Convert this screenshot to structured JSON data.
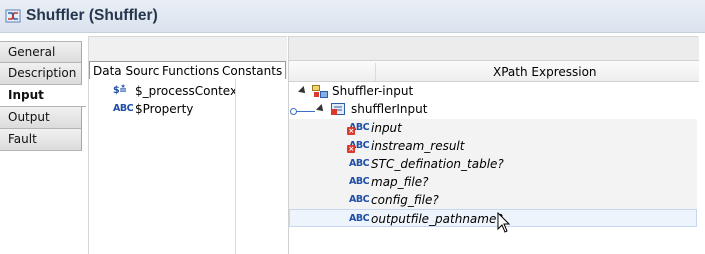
{
  "window": {
    "title": "Shuffler (Shuffler)",
    "icon": "shuffler-icon"
  },
  "tabs": [
    {
      "label": "General",
      "active": false
    },
    {
      "label": "Description",
      "active": false
    },
    {
      "label": "Input",
      "active": true
    },
    {
      "label": "Output",
      "active": false
    },
    {
      "label": "Fault",
      "active": false
    }
  ],
  "data_source_panel": {
    "subtabs": [
      {
        "label": "Data Source",
        "active": true
      },
      {
        "label": "Functions",
        "active": false
      },
      {
        "label": "Constants",
        "active": false
      }
    ],
    "items": [
      {
        "icon": "process-context-icon",
        "glyph": "$≛",
        "label": "$_processContext"
      },
      {
        "icon": "string-type-icon",
        "glyph": "ABC",
        "label": "$Property"
      }
    ]
  },
  "xpath_panel": {
    "column_header": "XPath Expression",
    "tree": {
      "root": {
        "label": "Shuffler-input",
        "icon": "schema-root-icon"
      },
      "child": {
        "label": "shufflerInput",
        "icon": "complex-element-icon"
      },
      "fields": [
        {
          "label": "input",
          "glyph": "ABC",
          "error": true
        },
        {
          "label": "instream_result",
          "glyph": "ABC",
          "error": true
        },
        {
          "label": "STC_defination_table?",
          "glyph": "ABC",
          "error": false
        },
        {
          "label": "map_file?",
          "glyph": "ABC",
          "error": false
        },
        {
          "label": "config_file?",
          "glyph": "ABC",
          "error": false
        },
        {
          "label": "outputfile_pathname?",
          "glyph": "ABC",
          "error": false
        }
      ]
    }
  },
  "colors": {
    "title_text": "#25364d",
    "type_icon": "#1f4fa8",
    "error_badge": "#d93a2b",
    "link": "#3a6fc4"
  }
}
